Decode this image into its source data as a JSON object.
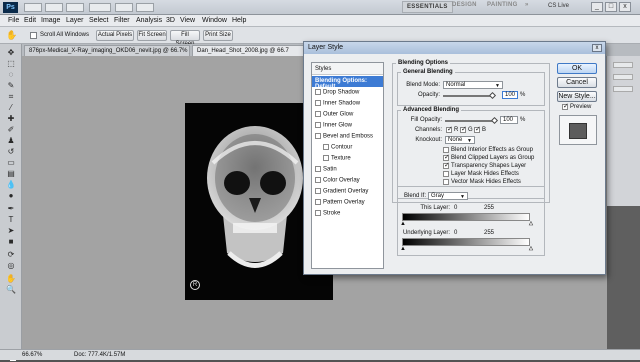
{
  "app": {
    "logo": "Ps",
    "workspaces": [
      "ESSENTIALS",
      "DESIGN",
      "PAINTING",
      "»"
    ],
    "cslive": "CS Live",
    "window_controls": [
      "_",
      "□",
      "x"
    ]
  },
  "menu": [
    "File",
    "Edit",
    "Image",
    "Layer",
    "Select",
    "Filter",
    "Analysis",
    "3D",
    "View",
    "Window",
    "Help"
  ],
  "options": {
    "scroll_all": "Scroll All Windows",
    "buttons": [
      "Actual Pixels",
      "Fit Screen",
      "Fill Screen",
      "Print Size"
    ]
  },
  "tabs": [
    "876px-Medical_X-Ray_imaging_OKD06_nevit.jpg @ 66.7% (RGB/8#)",
    "Dan_Head_Shot_2008.jpg @ 66.7"
  ],
  "status": {
    "zoom": "66.67%",
    "doc": "Doc: 777.4K/1.57M"
  },
  "dialog": {
    "title": "Layer Style",
    "styles_header": "Styles",
    "style_items": [
      {
        "label": "Blending Options: Default",
        "selected": true,
        "checkbox": false,
        "indent": false
      },
      {
        "label": "Drop Shadow",
        "selected": false,
        "checkbox": true,
        "indent": false
      },
      {
        "label": "Inner Shadow",
        "selected": false,
        "checkbox": true,
        "indent": false
      },
      {
        "label": "Outer Glow",
        "selected": false,
        "checkbox": true,
        "indent": false
      },
      {
        "label": "Inner Glow",
        "selected": false,
        "checkbox": true,
        "indent": false
      },
      {
        "label": "Bevel and Emboss",
        "selected": false,
        "checkbox": true,
        "indent": false
      },
      {
        "label": "Contour",
        "selected": false,
        "checkbox": true,
        "indent": true
      },
      {
        "label": "Texture",
        "selected": false,
        "checkbox": true,
        "indent": true
      },
      {
        "label": "Satin",
        "selected": false,
        "checkbox": true,
        "indent": false
      },
      {
        "label": "Color Overlay",
        "selected": false,
        "checkbox": true,
        "indent": false
      },
      {
        "label": "Gradient Overlay",
        "selected": false,
        "checkbox": true,
        "indent": false
      },
      {
        "label": "Pattern Overlay",
        "selected": false,
        "checkbox": true,
        "indent": false
      },
      {
        "label": "Stroke",
        "selected": false,
        "checkbox": true,
        "indent": false
      }
    ],
    "blending_options": "Blending Options",
    "general_blending": "General Blending",
    "blend_mode_label": "Blend Mode:",
    "blend_mode_value": "Normal",
    "opacity_label": "Opacity:",
    "opacity_value": "100",
    "opacity_level": 1.0,
    "percent": "%",
    "advanced_blending": "Advanced Blending",
    "fill_opacity_label": "Fill Opacity:",
    "fill_opacity_value": "100",
    "channels_label": "Channels:",
    "channels": [
      "R",
      "G",
      "B"
    ],
    "knockout_label": "Knockout:",
    "knockout_value": "None",
    "options": [
      {
        "label": "Blend Interior Effects as Group",
        "checked": false
      },
      {
        "label": "Blend Clipped Layers as Group",
        "checked": true
      },
      {
        "label": "Transparency Shapes Layer",
        "checked": true
      },
      {
        "label": "Layer Mask Hides Effects",
        "checked": false
      },
      {
        "label": "Vector Mask Hides Effects",
        "checked": false
      }
    ],
    "blend_if_label": "Blend If:",
    "blend_if_value": "Gray",
    "this_layer_label": "This Layer:",
    "underlying_label": "Underlying Layer:",
    "range_low": "0",
    "range_high": "255",
    "buttons": {
      "ok": "OK",
      "cancel": "Cancel",
      "new_style": "New Style...",
      "preview": "Preview"
    },
    "preview_checked": true,
    "close": "x"
  },
  "colors": {
    "selection": "#3d7bd4",
    "title_bar": "#a9bfdb",
    "workspace_bg": "#a3a3a3"
  }
}
